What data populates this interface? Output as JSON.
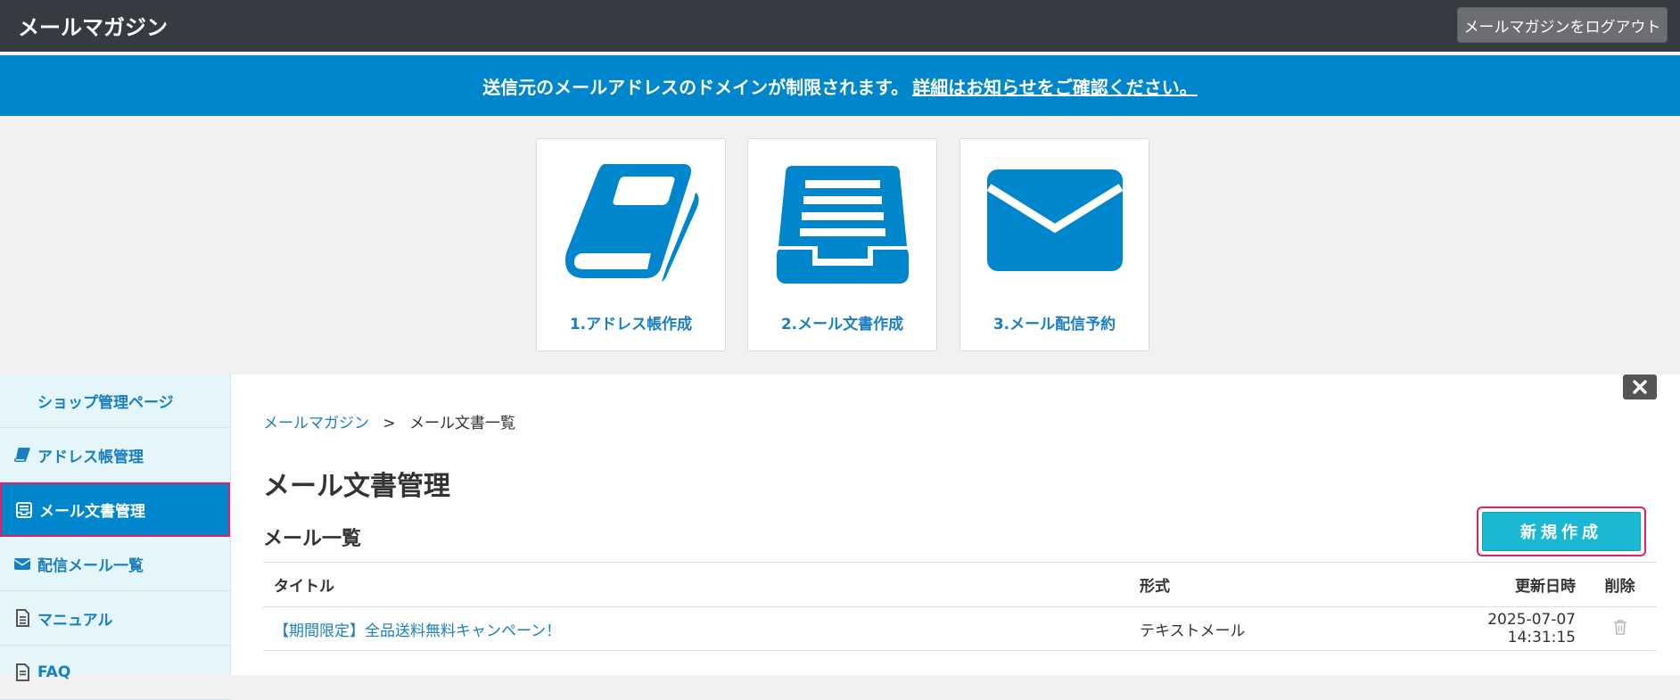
{
  "header": {
    "title": "メールマガジン",
    "logout_label": "メールマガジンをログアウト"
  },
  "notice": {
    "text": "送信元のメールアドレスのドメインが制限されます。",
    "link": "詳細はお知らせをご確認ください。"
  },
  "steps": [
    {
      "label": "1.アドレス帳作成",
      "icon": "address-book-icon"
    },
    {
      "label": "2.メール文書作成",
      "icon": "inbox-tray-icon"
    },
    {
      "label": "3.メール配信予約",
      "icon": "envelope-icon"
    }
  ],
  "sidebar": {
    "top_label": "ショップ管理ページ",
    "items": [
      {
        "label": "アドレス帳管理",
        "icon": "book-icon"
      },
      {
        "label": "メール文書管理",
        "icon": "inbox-icon"
      },
      {
        "label": "配信メール一覧",
        "icon": "envelope-icon"
      },
      {
        "label": "マニュアル",
        "icon": "document-icon"
      },
      {
        "label": "FAQ",
        "icon": "document-icon"
      }
    ]
  },
  "breadcrumb": {
    "root": "メールマガジン",
    "separator": ">",
    "current": "メール文書一覧"
  },
  "main": {
    "page_title": "メール文書管理",
    "section_title": "メール一覧",
    "new_button": "新規作成"
  },
  "table": {
    "headers": {
      "title": "タイトル",
      "format": "形式",
      "updated": "更新日時",
      "delete": "削除"
    },
    "rows": [
      {
        "title": "【期間限定】全品送料無料キャンペーン！",
        "format": "テキストメール",
        "updated": "2025-07-07 14:31:15"
      }
    ]
  },
  "colors": {
    "header_bg": "#373a41",
    "accent_blue": "#0086cc",
    "link_blue": "#1a7fc0",
    "new_button": "#1ab8d4",
    "highlight_pink": "#e0206a"
  }
}
